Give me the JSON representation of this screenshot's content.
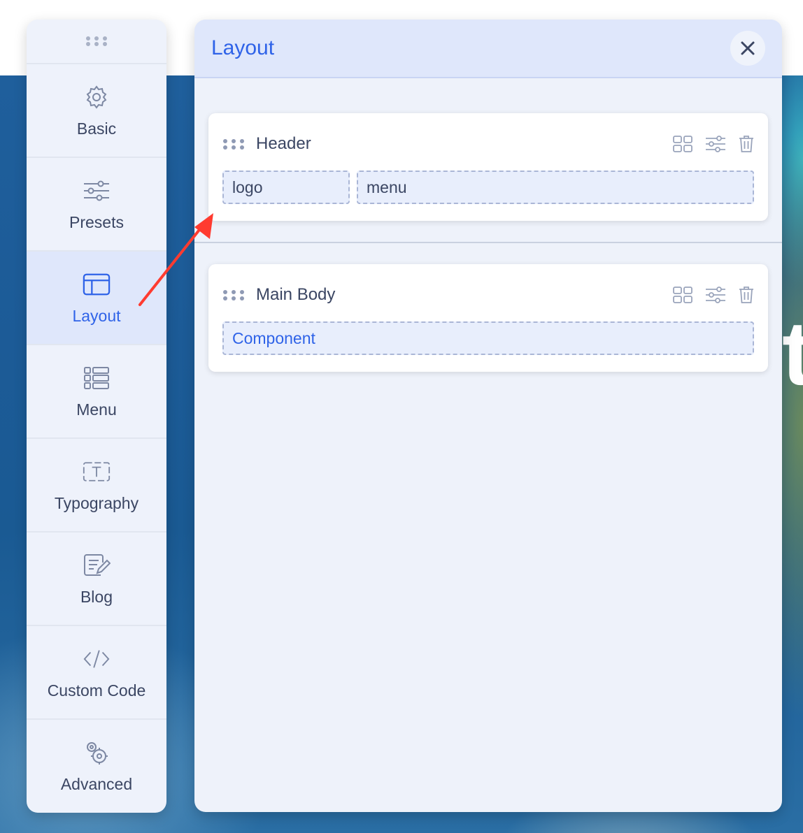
{
  "sidebar": {
    "items": [
      {
        "label": "Basic",
        "icon": "gear-icon"
      },
      {
        "label": "Presets",
        "icon": "sliders-icon"
      },
      {
        "label": "Layout",
        "icon": "layout-icon",
        "active": true
      },
      {
        "label": "Menu",
        "icon": "list-icon"
      },
      {
        "label": "Typography",
        "icon": "text-icon"
      },
      {
        "label": "Blog",
        "icon": "edit-document-icon"
      },
      {
        "label": "Custom Code",
        "icon": "code-icon"
      },
      {
        "label": "Advanced",
        "icon": "advanced-gears-icon"
      }
    ]
  },
  "panel": {
    "title": "Layout",
    "sections": [
      {
        "title": "Header",
        "slots": [
          "logo",
          "menu"
        ]
      },
      {
        "title": "Main Body",
        "slots": [
          "Component"
        ]
      }
    ]
  },
  "colors": {
    "accent": "#2f63e8",
    "text": "#3b4663",
    "annotation_arrow": "#ff3b30"
  }
}
